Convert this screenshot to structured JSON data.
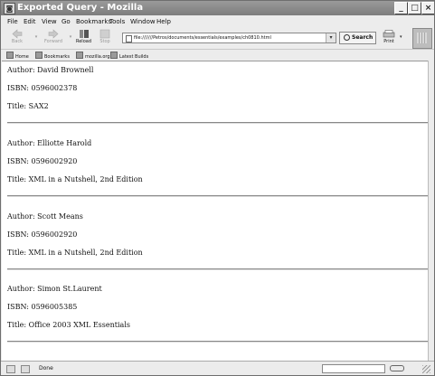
{
  "window": {
    "title": "Exported Query - Mozilla"
  },
  "menu": [
    "File",
    "Edit",
    "View",
    "Go",
    "Bookmarks",
    "Tools",
    "Window",
    "Help"
  ],
  "toolbar": {
    "back": "Back",
    "forward": "Forward",
    "reload": "Reload",
    "stop": "Stop",
    "url": "file:///////Petros/documents/essentials/examples/ch0810.html",
    "search": "Search",
    "print": "Print"
  },
  "personal_toolbar": [
    "Home",
    "Bookmarks",
    "mozilla.org",
    "Latest Builds"
  ],
  "records": [
    {
      "author": "Author: David Brownell",
      "isbn": "ISBN: 0596002378",
      "title": "Title: SAX2"
    },
    {
      "author": "Author: Elliotte Harold",
      "isbn": "ISBN: 0596002920",
      "title": "Title: XML in a Nutshell, 2nd Edition"
    },
    {
      "author": "Author: Scott Means",
      "isbn": "ISBN: 0596002920",
      "title": "Title: XML in a Nutshell, 2nd Edition"
    },
    {
      "author": "Author: Simon St.Laurent",
      "isbn": "ISBN: 0596005385",
      "title": "Title: Office 2003 XML Essentials"
    }
  ],
  "status": {
    "text": "Done"
  }
}
